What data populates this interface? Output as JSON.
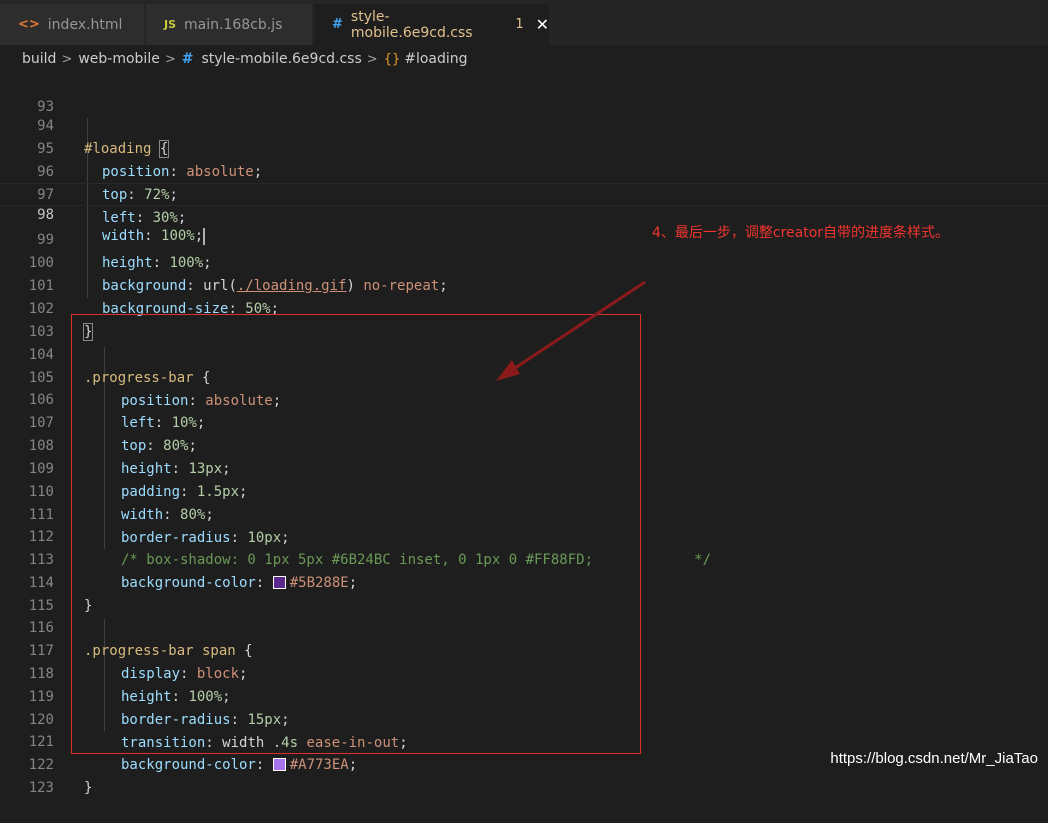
{
  "tabs": [
    {
      "icon": "<>",
      "label": "index.html",
      "active": false
    },
    {
      "icon": "JS",
      "label": "main.168cb.js",
      "active": false
    },
    {
      "icon": "#",
      "label": "style-mobile.6e9cd.css",
      "active": true,
      "badge": "1",
      "close": "✕"
    }
  ],
  "breadcrumb": {
    "items": [
      "build",
      "web-mobile",
      "style-mobile.6e9cd.css",
      "#loading"
    ],
    "separator": ">",
    "file_icon": "#",
    "symbol_icon": "{}"
  },
  "code": {
    "current_line": 98,
    "lines": [
      {
        "n": "93"
      },
      {
        "n": "94",
        "sel": "#loading",
        "open": "{"
      },
      {
        "n": "95",
        "prop": "position",
        "val": "absolute"
      },
      {
        "n": "96",
        "prop": "top",
        "num": "72%"
      },
      {
        "n": "97",
        "prop": "left",
        "num": "30%"
      },
      {
        "n": "98",
        "prop": "width",
        "num": "100%"
      },
      {
        "n": "99",
        "prop": "height",
        "num": "100%"
      },
      {
        "n": "100",
        "prop": "background",
        "url_fn": "url(",
        "url": "./loading.gif",
        "url_close": ")",
        "val": "no-repeat"
      },
      {
        "n": "101",
        "prop": "background-size",
        "num": "50%"
      },
      {
        "n": "102",
        "close": "}"
      },
      {
        "n": "103"
      },
      {
        "n": "104",
        "sel": ".progress-bar",
        "open": "{"
      },
      {
        "n": "105",
        "prop": "position",
        "val": "absolute"
      },
      {
        "n": "106",
        "prop": "left",
        "num": "10%"
      },
      {
        "n": "107",
        "prop": "top",
        "num": "80%"
      },
      {
        "n": "108",
        "prop": "height",
        "num": "13px"
      },
      {
        "n": "109",
        "prop": "padding",
        "num": "1.5px"
      },
      {
        "n": "110",
        "prop": "width",
        "num": "80%"
      },
      {
        "n": "111",
        "prop": "border-radius",
        "num": "10px"
      },
      {
        "n": "112",
        "comment": "/* box-shadow: 0 1px 5px #6B24BC inset, 0 1px 0 #FF88FD;            */"
      },
      {
        "n": "113",
        "prop": "background-color",
        "color": "#5B288E"
      },
      {
        "n": "114",
        "close": "}"
      },
      {
        "n": "115"
      },
      {
        "n": "116",
        "sel": ".progress-bar span",
        "open": "{"
      },
      {
        "n": "117",
        "prop": "display",
        "val": "block"
      },
      {
        "n": "118",
        "prop": "height",
        "num": "100%"
      },
      {
        "n": "119",
        "prop": "border-radius",
        "num": "15px"
      },
      {
        "n": "120",
        "prop": "transition",
        "trans_a": "width",
        "trans_b": ".4s",
        "val": "ease-in-out"
      },
      {
        "n": "121",
        "prop": "background-color",
        "color": "#A773EA"
      },
      {
        "n": "122",
        "close": "}"
      },
      {
        "n": "123"
      }
    ]
  },
  "annotation": {
    "note": "4、最后一步，调整creator自带的进度条样式。",
    "color": "#f0352e"
  },
  "watermark": "https://blog.csdn.net/Mr_JiaTao"
}
